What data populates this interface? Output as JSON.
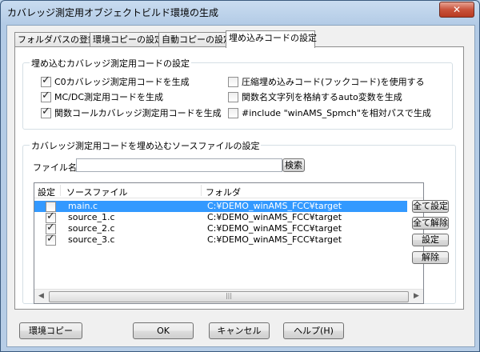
{
  "window": {
    "title": "カバレッジ測定用オブジェクトビルド環境の生成",
    "close": "✕"
  },
  "tabs": [
    {
      "label": "フォルダパスの登録",
      "active": false
    },
    {
      "label": "環境コピーの設定",
      "active": false
    },
    {
      "label": "自動コピーの設定",
      "active": false
    },
    {
      "label": "埋め込みコードの設定",
      "active": true
    }
  ],
  "embed_group": {
    "title": "埋め込むカバレッジ測定用コードの設定",
    "options": [
      {
        "label": "C0カバレッジ測定用コードを生成",
        "checked": true
      },
      {
        "label": "MC/DC測定用コードを生成",
        "checked": true
      },
      {
        "label": "関数コールカバレッジ測定用コードを生成",
        "checked": true
      },
      {
        "label": "圧縮埋め込みコード(フックコード)を使用する",
        "checked": false
      },
      {
        "label": "関数名文字列を格納するauto変数を生成",
        "checked": false
      },
      {
        "label": "#include \"winAMS_Spmch\"を相対パスで生成",
        "checked": false
      }
    ]
  },
  "source_group": {
    "title": "カバレッジ測定用コードを埋め込むソースファイルの設定",
    "filename_label": "ファイル名:",
    "filename_value": "",
    "search_button": "検索",
    "columns": [
      "設定",
      "ソースファイル",
      "フォルダ"
    ],
    "rows": [
      {
        "checked": false,
        "file": "main.c",
        "folder": "C:¥DEMO_winAMS_FCC¥target",
        "selected": true
      },
      {
        "checked": true,
        "file": "source_1.c",
        "folder": "C:¥DEMO_winAMS_FCC¥target",
        "selected": false
      },
      {
        "checked": true,
        "file": "source_2.c",
        "folder": "C:¥DEMO_winAMS_FCC¥target",
        "selected": false
      },
      {
        "checked": true,
        "file": "source_3.c",
        "folder": "C:¥DEMO_winAMS_FCC¥target",
        "selected": false
      }
    ],
    "side_buttons": {
      "set_all": "全て設定",
      "clear_all": "全て解除",
      "set": "設定",
      "clear": "解除"
    }
  },
  "footer": {
    "env_copy": "環境コピー",
    "ok": "OK",
    "cancel": "キャンセル",
    "help": "ヘルプ(H)"
  }
}
